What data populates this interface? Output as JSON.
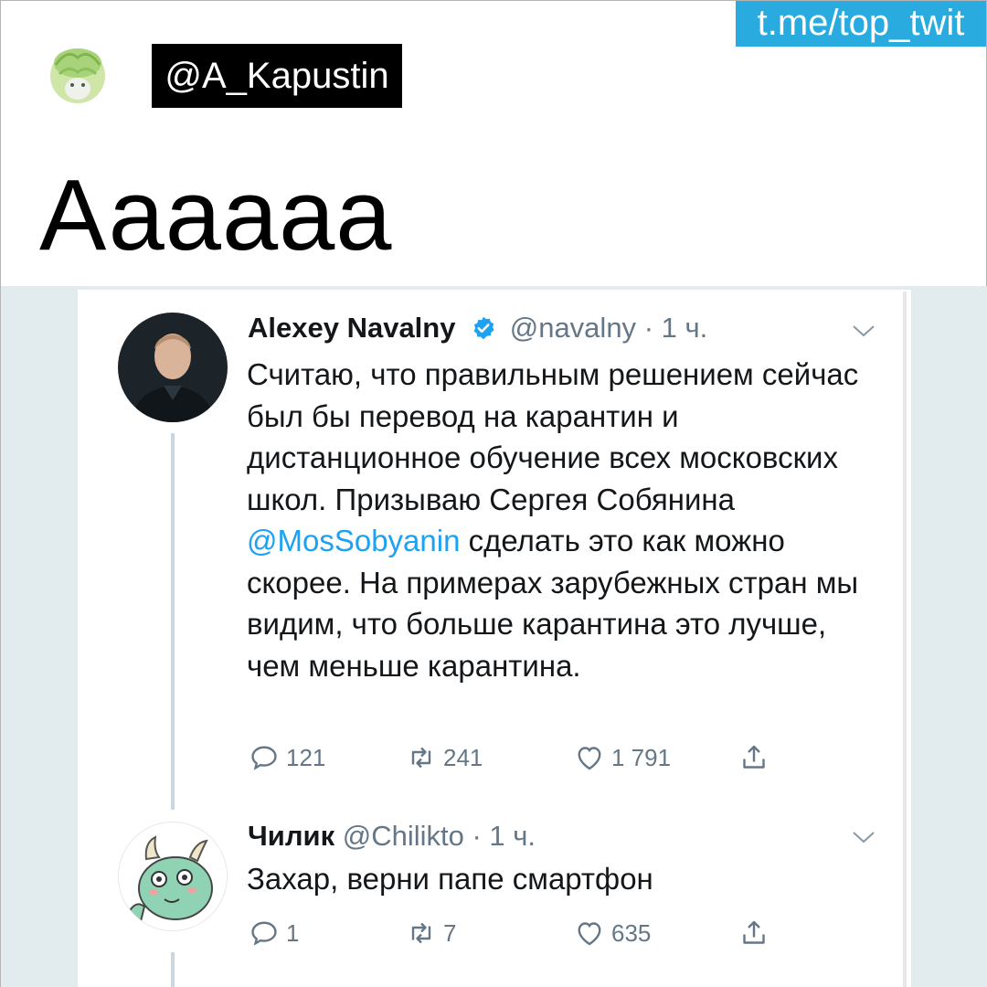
{
  "post": {
    "channel": "t.me/top_twit",
    "author_handle": "@A_Kapustin",
    "caption": "Аааааа"
  },
  "tweets": [
    {
      "name": "Alexey Navalny",
      "verified": true,
      "handle": "@navalny",
      "time": "· 1 ч.",
      "text_before": "Считаю, что правильным решением сейчас был бы перевод на карантин и дистанционное обучение всех московских школ. Призываю Сергея Собянина ",
      "mention": "@MosSobyanin",
      "text_after": " сделать это как можно скорее. На примерах зарубежных стран мы видим, что больше карантина это лучше, чем меньше карантина.",
      "replies": "121",
      "retweets": "241",
      "likes": "1 791"
    },
    {
      "name": "Чилик",
      "verified": false,
      "handle": "@Chilikto",
      "time": "· 1 ч.",
      "text": "Захар, верни папе смартфон",
      "replies": "1",
      "retweets": "7",
      "likes": "635"
    }
  ],
  "icons": {
    "reply": "reply-icon",
    "retweet": "retweet-icon",
    "like": "heart-icon",
    "share": "share-icon",
    "verified": "verified-badge-icon",
    "menu": "chevron-down-icon"
  },
  "colors": {
    "channel_tag": "#2aabdf",
    "handle_box": "#000000",
    "link": "#1da1f2",
    "verified": "#1da1f2",
    "meta": "#657786",
    "screenshot_bg": "#e2ecee"
  }
}
